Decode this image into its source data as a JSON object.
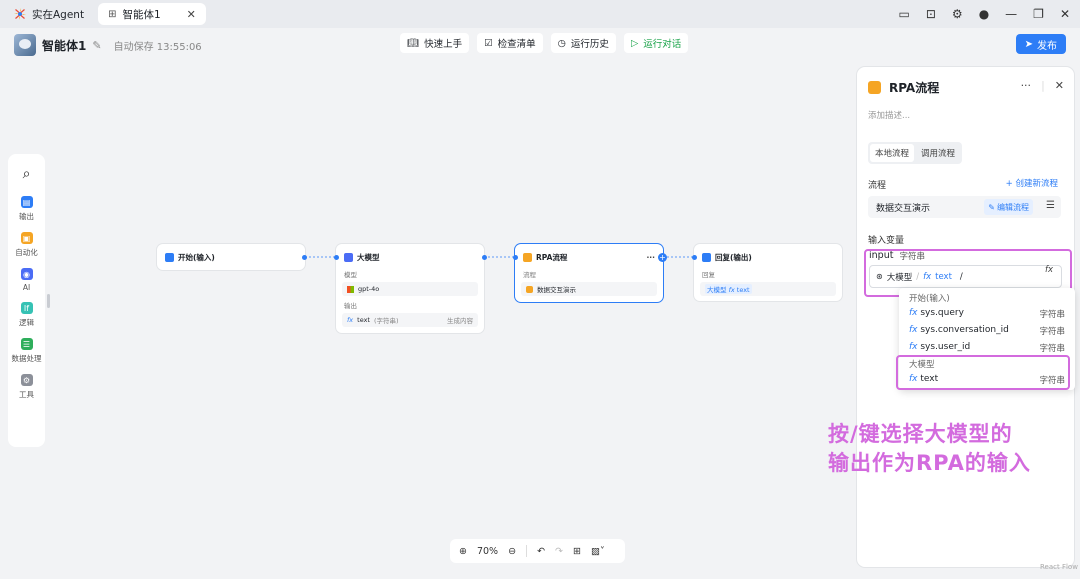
{
  "titlebar": {
    "tabs": [
      {
        "label": "实在Agent",
        "active": false
      },
      {
        "label": "智能体1",
        "active": true
      }
    ]
  },
  "header": {
    "agent_name": "智能体1",
    "saved_text": "自动保存 13:55:06",
    "toolbar": {
      "quick_start": "快速上手",
      "checklist": "检查清单",
      "run_history": "运行历史",
      "run_chat": "运行对话"
    },
    "publish": "发布"
  },
  "left_panel": {
    "items": [
      {
        "label": "输出",
        "color": "#2d7df6"
      },
      {
        "label": "自动化",
        "color": "#f5a524"
      },
      {
        "label": "AI",
        "color": "#4b6cf5"
      },
      {
        "label": "逻辑",
        "color": "#36c2b4"
      },
      {
        "label": "数据处理",
        "color": "#2eae5b"
      },
      {
        "label": "工具",
        "color": "#8c9099"
      }
    ]
  },
  "canvas": {
    "nodes": {
      "start": {
        "title": "开始(输入)"
      },
      "llm": {
        "title": "大模型",
        "model_label": "模型",
        "model_value": "gpt-4o",
        "output_label": "输出",
        "output_var": "text",
        "output_type": "(字符串)",
        "output_desc": "生成内容"
      },
      "rpa": {
        "title": "RPA流程",
        "flow_label": "流程",
        "flow_value": "数据交互演示"
      },
      "reply": {
        "title": "回复(输出)",
        "reply_label": "回复",
        "tag_source": "大模型",
        "tag_var": "text"
      }
    },
    "zoom": "70%"
  },
  "right_panel": {
    "title": "RPA流程",
    "description_placeholder": "添加描述...",
    "segments": {
      "local": "本地流程",
      "remote": "调用流程"
    },
    "flow_label": "流程",
    "create_flow": "+ 创建新流程",
    "flow_value": "数据交互演示",
    "edit_flow": "编辑流程",
    "input_vars_label": "输入变量",
    "input_name": "input",
    "input_type": "字符串",
    "input_source": "大模型",
    "input_var": "text",
    "input_cursor": "/",
    "dropdown": {
      "group_start": "开始(输入)",
      "start_items": [
        {
          "name": "sys.query",
          "type": "字符串"
        },
        {
          "name": "sys.conversation_id",
          "type": "字符串"
        },
        {
          "name": "sys.user_id",
          "type": "字符串"
        }
      ],
      "group_llm": "大模型",
      "llm_items": [
        {
          "name": "text",
          "type": "字符串"
        }
      ]
    }
  },
  "annotation": {
    "line1": "按/键选择大模型的",
    "line2": "输出作为RPA的输入",
    "color": "#d36bde"
  },
  "watermark": "React Flow"
}
